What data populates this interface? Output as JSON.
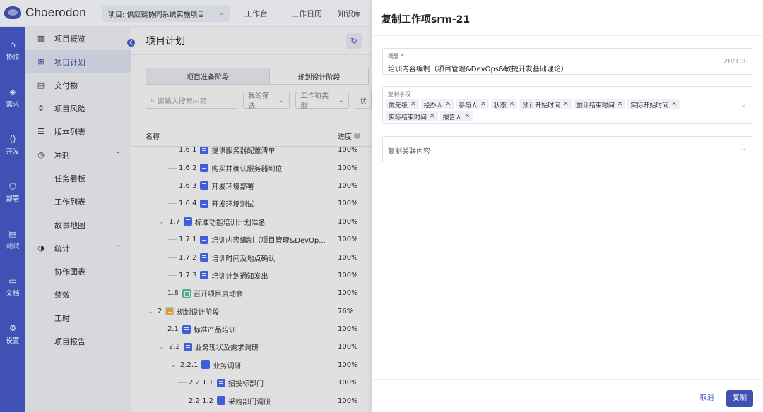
{
  "app": {
    "logo_text": "Choerodon"
  },
  "header": {
    "project_select": "项目: 供应链协同系统实施项目",
    "nav": [
      "工作台",
      "工作日历",
      "知识库"
    ]
  },
  "iconbar": [
    {
      "label": "协作",
      "icon": "collaborate-icon",
      "glyph": "⌂"
    },
    {
      "label": "需求",
      "icon": "requirement-icon",
      "glyph": "◈"
    },
    {
      "label": "开发",
      "icon": "code-icon",
      "glyph": "⟨⟩"
    },
    {
      "label": "部署",
      "icon": "deploy-icon",
      "glyph": "⬡"
    },
    {
      "label": "测试",
      "icon": "test-icon",
      "glyph": "▤"
    },
    {
      "label": "文档",
      "icon": "docs-icon",
      "glyph": "▭"
    },
    {
      "label": "设置",
      "icon": "settings-icon",
      "glyph": "⚙"
    }
  ],
  "sidebar": [
    {
      "label": "项目概览",
      "glyph": "▥",
      "icon": "overview-icon"
    },
    {
      "label": "项目计划",
      "glyph": "⊞",
      "icon": "plan-icon",
      "active": true
    },
    {
      "label": "交付物",
      "glyph": "▤",
      "icon": "deliverable-icon"
    },
    {
      "label": "项目风险",
      "glyph": "✲",
      "icon": "risk-icon"
    },
    {
      "label": "版本列表",
      "glyph": "☰",
      "icon": "version-icon"
    },
    {
      "label": "冲刺",
      "glyph": "◷",
      "icon": "sprint-icon",
      "expand": "⌃"
    },
    {
      "label": "任务看板",
      "sub": true
    },
    {
      "label": "工作列表",
      "sub": true
    },
    {
      "label": "故事地图",
      "sub": true
    },
    {
      "label": "统计",
      "glyph": "◑",
      "icon": "stats-icon",
      "expand": "⌃"
    },
    {
      "label": "协作图表",
      "sub": true
    },
    {
      "label": "绩效",
      "sub": true
    },
    {
      "label": "工时",
      "sub": true
    },
    {
      "label": "项目报告",
      "sub": true
    }
  ],
  "main": {
    "title": "项目计划",
    "stages": [
      "项目准备阶段",
      "规划设计阶段"
    ],
    "search_placeholder": "请输入搜索内容",
    "filter_mine": "我的筛选",
    "filter_type": "工作项类型",
    "filter_extra": "状",
    "col_name": "名称",
    "col_progress": "进度",
    "rows": [
      {
        "num": "1.6.1",
        "title": "提供服务器配置清单",
        "type": "task",
        "level": 3,
        "progress": "100%",
        "cut": true
      },
      {
        "num": "1.6.2",
        "title": "购买并确认服务器到位",
        "type": "task",
        "level": 3,
        "progress": "100%"
      },
      {
        "num": "1.6.3",
        "title": "开发环境部署",
        "type": "task",
        "level": 3,
        "progress": "100%"
      },
      {
        "num": "1.6.4",
        "title": "开发环境测试",
        "type": "task",
        "level": 3,
        "progress": "100%"
      },
      {
        "num": "1.7",
        "title": "标准功能培训计划准备",
        "type": "task",
        "level": 2,
        "toggle": "⌄",
        "progress": "100%"
      },
      {
        "num": "1.7.1",
        "title": "培训内容编制（项目管理&DevOp...",
        "type": "task",
        "level": 3,
        "progress": "100%"
      },
      {
        "num": "1.7.2",
        "title": "培训时间及地点确认",
        "type": "task",
        "level": 3,
        "progress": "100%"
      },
      {
        "num": "1.7.3",
        "title": "培训计划通知发出",
        "type": "task",
        "level": 3,
        "progress": "100%"
      },
      {
        "num": "1.8",
        "title": "召开项目启动会",
        "type": "mile",
        "level": 2,
        "progress": "100%"
      },
      {
        "num": "2",
        "title": "规划设计阶段",
        "type": "stage",
        "level": 1,
        "toggle": "⌄",
        "progress": "76%"
      },
      {
        "num": "2.1",
        "title": "标准产品培训",
        "type": "task",
        "level": 2,
        "progress": "100%"
      },
      {
        "num": "2.2",
        "title": "业务现状及需求调研",
        "type": "task",
        "level": 2,
        "toggle": "⌄",
        "progress": "100%"
      },
      {
        "num": "2.2.1",
        "title": "业务调研",
        "type": "task",
        "level": 3,
        "toggle": "⌄",
        "progress": "100%"
      },
      {
        "num": "2.2.1.1",
        "title": "招投标部门",
        "type": "task",
        "level": 4,
        "progress": "100%"
      },
      {
        "num": "2.2.1.2",
        "title": "采购部门调研",
        "type": "task",
        "level": 4,
        "progress": "100%"
      }
    ]
  },
  "drawer": {
    "title": "复制工作项srm-21",
    "summary_label": "概要",
    "required_mark": "*",
    "summary_value": "培训内容编制（项目管理&DevOps&敏捷开发基础理论）",
    "summary_count": "28/100",
    "copy_fields_label": "复制字段",
    "copy_fields": [
      "优先级",
      "经办人",
      "参与人",
      "状态",
      "预计开始时间",
      "预计结束时间",
      "实际开始时间",
      "实际结束时间",
      "报告人"
    ],
    "related_label": "复制关联内容",
    "cancel_label": "取消",
    "copy_label": "复制"
  }
}
